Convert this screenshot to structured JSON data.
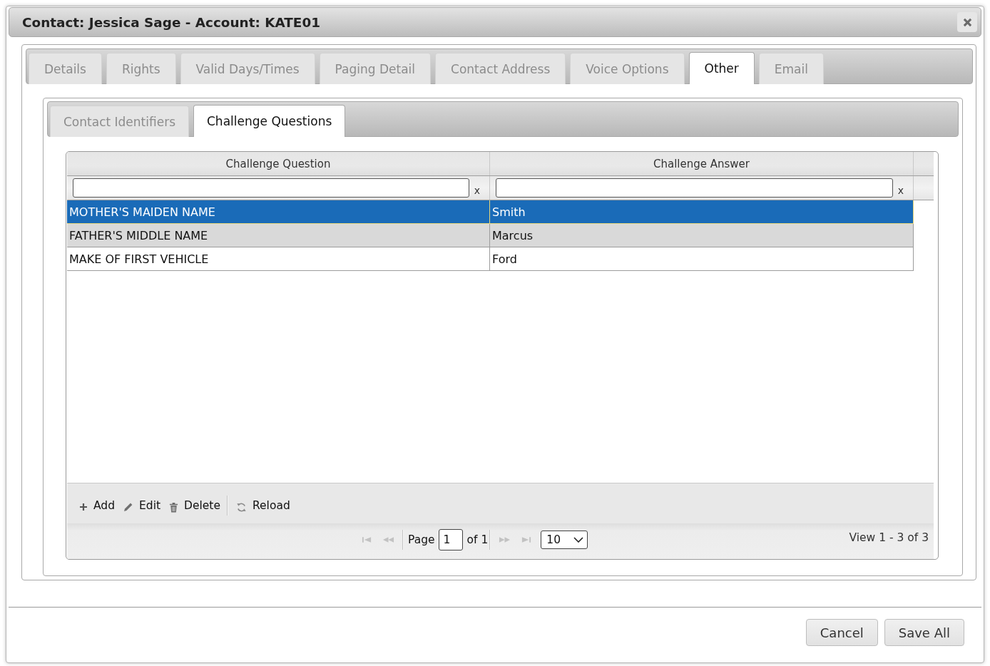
{
  "window": {
    "title": "Contact: Jessica Sage - Account: KATE01"
  },
  "tabs": [
    {
      "label": "Details",
      "selected": false
    },
    {
      "label": "Rights",
      "selected": false
    },
    {
      "label": "Valid Days/Times",
      "selected": false
    },
    {
      "label": "Paging Detail",
      "selected": false
    },
    {
      "label": "Contact Address",
      "selected": false
    },
    {
      "label": "Voice Options",
      "selected": false
    },
    {
      "label": "Other",
      "selected": true
    },
    {
      "label": "Email",
      "selected": false
    }
  ],
  "subtabs": [
    {
      "label": "Contact Identifiers",
      "selected": false
    },
    {
      "label": "Challenge Questions",
      "selected": true
    }
  ],
  "grid": {
    "columns": [
      {
        "label": "Challenge Question"
      },
      {
        "label": "Challenge Answer"
      }
    ],
    "filters": [
      {
        "clear": "x"
      },
      {
        "clear": "x"
      }
    ],
    "rows": [
      {
        "cells": [
          "MOTHER'S MAIDEN NAME",
          "Smith"
        ],
        "selected": true,
        "highlighted": false
      },
      {
        "cells": [
          "FATHER'S MIDDLE NAME",
          "Marcus"
        ],
        "selected": false,
        "highlighted": true
      },
      {
        "cells": [
          "MAKE OF FIRST VEHICLE",
          "Ford"
        ],
        "selected": false,
        "highlighted": false
      }
    ],
    "toolbar": [
      {
        "kind": "add",
        "label": "Add"
      },
      {
        "kind": "edit",
        "label": "Edit"
      },
      {
        "kind": "delete",
        "label": "Delete"
      },
      {
        "kind": "separator"
      },
      {
        "kind": "reload",
        "label": "Reload"
      }
    ],
    "pager": {
      "nav_buttons": [
        {
          "kind": "first",
          "disabled": true
        },
        {
          "kind": "prev",
          "disabled": true
        },
        {
          "kind": "next",
          "disabled": true
        },
        {
          "kind": "last",
          "disabled": true
        }
      ],
      "page_label": "Page",
      "page": "1",
      "total_label": "of 1",
      "page_size": "10",
      "summary": "View 1 - 3 of 3"
    }
  },
  "footer": {
    "buttons": [
      "Cancel",
      "Save All"
    ]
  }
}
